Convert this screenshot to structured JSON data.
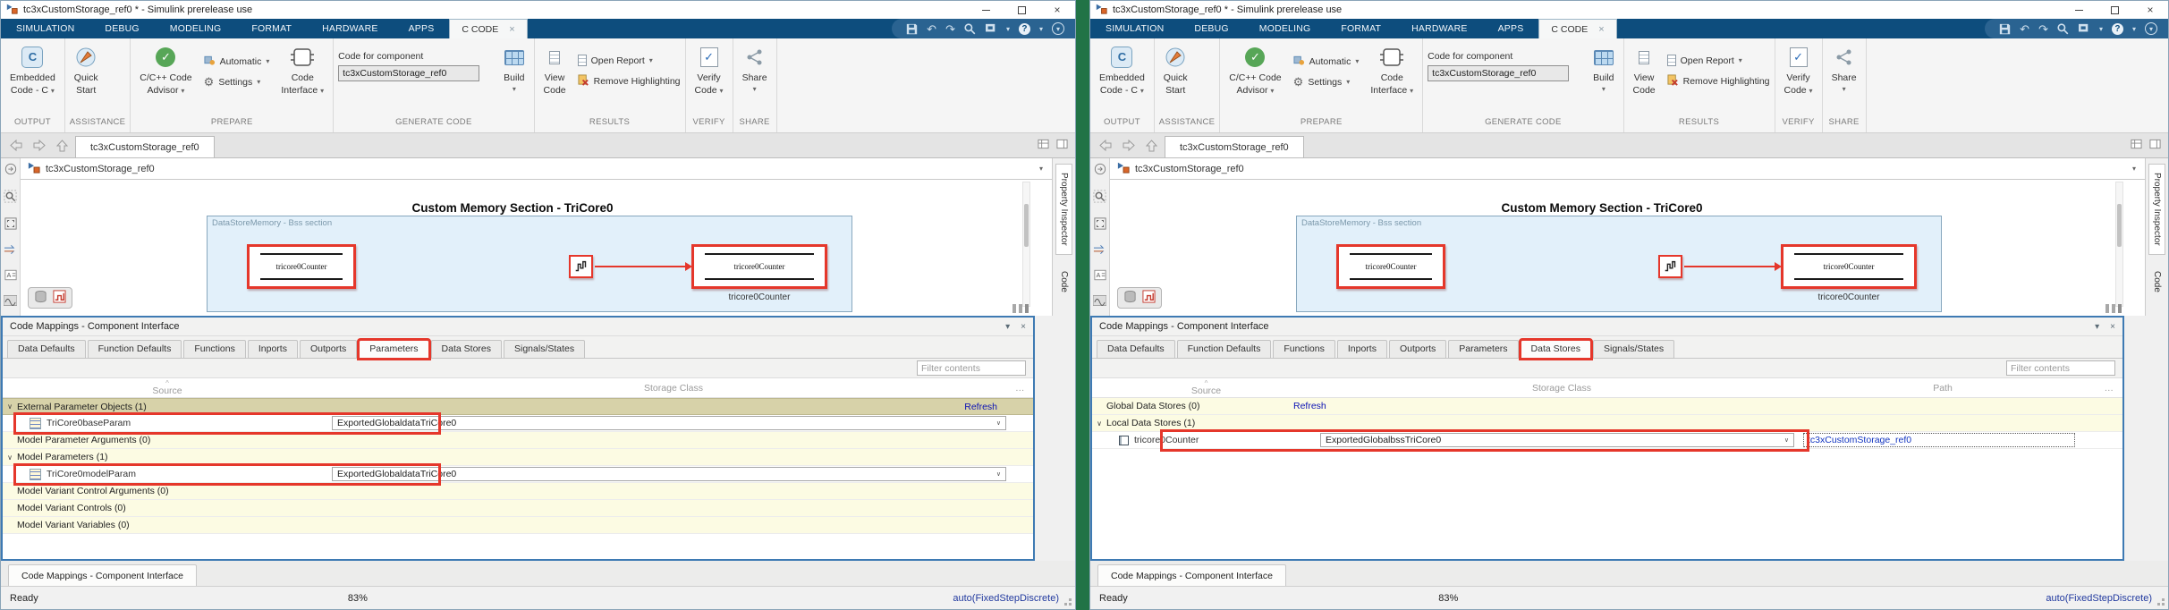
{
  "icons": {
    "close": "×",
    "dropdown": "▾",
    "caret_open": "∨",
    "combo_chevron": "∨",
    "sort_asc": "^",
    "more": "…",
    "gear": "⚙",
    "undo": "↶",
    "redo": "↷",
    "help": "?",
    "collapse": "▾",
    "c_badge": "C",
    "check": "✓",
    "breadcrumb_dropdown": "▾"
  },
  "shared": {
    "titlebar": {
      "title": "tc3xCustomStorage_ref0 * - Simulink prerelease use"
    },
    "menu": {
      "tabs": [
        "SIMULATION",
        "DEBUG",
        "MODELING",
        "FORMAT",
        "HARDWARE",
        "APPS"
      ],
      "active_tab": "C CODE"
    },
    "ribbon": {
      "output": {
        "l1": "Embedded",
        "l2": "Code - C",
        "group": "OUTPUT"
      },
      "assist": {
        "l1": "Quick",
        "l2": "Start",
        "group": "ASSISTANCE"
      },
      "prepare": {
        "adv1": "C/C++ Code",
        "adv2": "Advisor",
        "automatic": "Automatic",
        "settings": "Settings",
        "ci1": "Code",
        "ci2": "Interface",
        "group": "PREPARE"
      },
      "gen": {
        "label": "Code for component",
        "value": "tc3xCustomStorage_ref0",
        "build": "Build",
        "group": "GENERATE CODE"
      },
      "results": {
        "v1": "View",
        "v2": "Code",
        "open": "Open Report",
        "remove": "Remove Highlighting",
        "group": "RESULTS"
      },
      "verify": {
        "l1": "Verify",
        "l2": "Code",
        "group": "VERIFY"
      },
      "share": {
        "l1": "Share",
        "group": "SHARE"
      }
    },
    "doc": {
      "tab": "tc3xCustomStorage_ref0",
      "breadcrumb": "tc3xCustomStorage_ref0"
    },
    "canvas": {
      "title": "Custom Memory Section - TriCore0",
      "region_label": "DataStoreMemory - Bss section",
      "datastore_name": "tricore0Counter",
      "writer_label": "tricore0Counter"
    },
    "side_tabs": {
      "property_inspector": "Property Inspector",
      "code": "Code"
    },
    "panel": {
      "title": "Code Mappings - Component Interface",
      "tabs": [
        "Data Defaults",
        "Function Defaults",
        "Functions",
        "Inports",
        "Outports",
        "Parameters",
        "Data Stores",
        "Signals/States"
      ],
      "filter_placeholder": "Filter contents"
    },
    "bottom_tab": "Code Mappings - Component Interface",
    "status": {
      "ready": "Ready",
      "zoom": "83%",
      "solver": "auto(FixedStepDiscrete)"
    }
  },
  "win1": {
    "active_panel_tab": "Parameters",
    "table": {
      "col_source": "Source",
      "col_storage": "Storage Class",
      "refresh": "Refresh",
      "group_external": "External Parameter Objects (1)",
      "row_base": {
        "name": "TriCore0baseParam",
        "storage": "ExportedGlobaldataTriCore0"
      },
      "group_args": "Model Parameter Arguments (0)",
      "group_model": "Model Parameters (1)",
      "row_model": {
        "name": "TriCore0modelParam",
        "storage": "ExportedGlobaldataTriCore0"
      },
      "group_variant_args": "Model Variant Control Arguments (0)",
      "group_variant_controls": "Model Variant Controls (0)",
      "group_variant_vars": "Model Variant Variables (0)"
    }
  },
  "win2": {
    "active_panel_tab": "Data Stores",
    "table": {
      "col_source": "Source",
      "col_storage": "Storage Class",
      "col_path": "Path",
      "refresh": "Refresh",
      "group_global": "Global Data Stores (0)",
      "group_local": "Local Data Stores (1)",
      "row_counter": {
        "name": "tricore0Counter",
        "storage": "ExportedGlobalbssTriCore0",
        "path": "tc3xCustomStorage_ref0"
      }
    }
  }
}
